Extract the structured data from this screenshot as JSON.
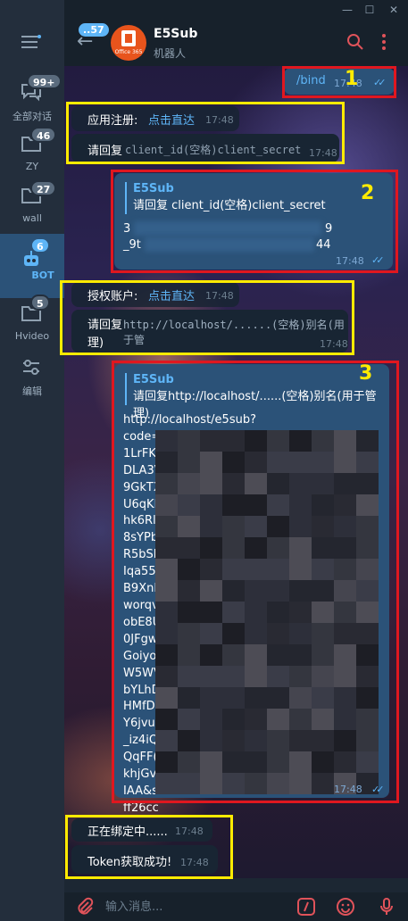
{
  "window": {
    "minimize_icon": "minimize-icon",
    "maximize_icon": "maximize-icon",
    "close_icon": "close-icon"
  },
  "sidebar": {
    "menu_icon": "menu-icon",
    "folders": [
      {
        "label": "全部对话",
        "badge": "99+",
        "icon": "chat-bubbles-icon"
      },
      {
        "label": "ZY",
        "badge": "46",
        "icon": "folder-icon"
      },
      {
        "label": "wall",
        "badge": "27",
        "icon": "folder-icon"
      },
      {
        "label": "BOT",
        "badge": "6",
        "icon": "robot-icon"
      },
      {
        "label": "Hvideo",
        "badge": "5",
        "icon": "folder-icon"
      },
      {
        "label": "编辑",
        "icon": "sliders-icon"
      }
    ]
  },
  "header": {
    "back_badge": "..57",
    "title": "E5Sub",
    "subtitle": "机器人",
    "avatar_text": "Office 365"
  },
  "messages": {
    "m1": {
      "text": "/bind",
      "time": "17:48"
    },
    "m2": {
      "button": "应用注册:",
      "link": "点击直达",
      "btn_time": "17:48",
      "text": "请回复",
      "code": "client_id(空格)client_secret",
      "time": "17:48"
    },
    "m3": {
      "quote_name": "E5Sub",
      "quote_text": "请回复 client_id(空格)client_secret",
      "line1": "3",
      "line1b": "9",
      "line2": "_9t",
      "line2b": "44",
      "time": "17:48"
    },
    "m4": {
      "button": "授权账户:",
      "link": "点击直达",
      "btn_time": "17:48",
      "text": "请回复",
      "code": "http://localhost/......(空格)别名(用于管",
      "text2": "理)",
      "time": "17:48"
    },
    "m5": {
      "quote_name": "E5Sub",
      "quote_text": "请回复http://localhost/......(空格)别名(用于管理)",
      "lines": [
        "http://localhost/e5sub?",
        "code=",
        "1LrFK",
        "DLA3V",
        "9GkTX",
        "U6qKl",
        "hk6Rl",
        "8sYPb",
        "R5bSN",
        "Iqa55",
        "B9XnF",
        "worqv",
        "obE8U",
        "0JFgw",
        "Goiyo",
        "W5WV",
        "bYLhD",
        "HMfD",
        "Y6jvul",
        "_iz4iQ",
        "QqFF(",
        "khjGv",
        "IAA&s",
        "ff26cc"
      ],
      "time": "17:48"
    },
    "m6": {
      "text": "正在绑定中......",
      "time": "17:48"
    },
    "m7": {
      "text": "Token获取成功!",
      "time": "17:48"
    }
  },
  "annotations": {
    "n1": "1",
    "n2": "2",
    "n3": "3"
  },
  "input": {
    "placeholder": "输入消息...",
    "attach_icon": "paperclip-icon",
    "command_icon": "slash-command-icon",
    "emoji_icon": "emoji-icon",
    "mic_icon": "microphone-icon"
  }
}
